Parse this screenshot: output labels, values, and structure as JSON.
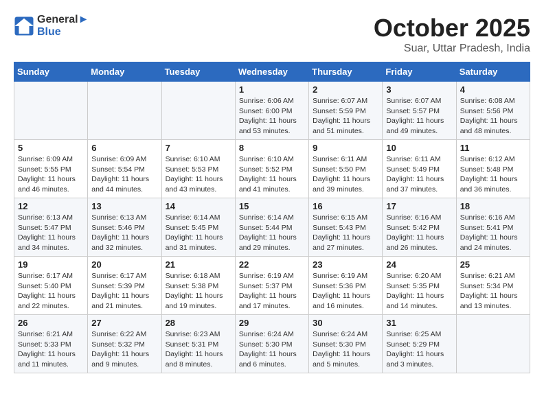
{
  "header": {
    "logo_line1": "General",
    "logo_line2": "Blue",
    "month": "October 2025",
    "location": "Suar, Uttar Pradesh, India"
  },
  "weekdays": [
    "Sunday",
    "Monday",
    "Tuesday",
    "Wednesday",
    "Thursday",
    "Friday",
    "Saturday"
  ],
  "weeks": [
    [
      {
        "day": "",
        "info": ""
      },
      {
        "day": "",
        "info": ""
      },
      {
        "day": "",
        "info": ""
      },
      {
        "day": "1",
        "info": "Sunrise: 6:06 AM\nSunset: 6:00 PM\nDaylight: 11 hours and 53 minutes."
      },
      {
        "day": "2",
        "info": "Sunrise: 6:07 AM\nSunset: 5:59 PM\nDaylight: 11 hours and 51 minutes."
      },
      {
        "day": "3",
        "info": "Sunrise: 6:07 AM\nSunset: 5:57 PM\nDaylight: 11 hours and 49 minutes."
      },
      {
        "day": "4",
        "info": "Sunrise: 6:08 AM\nSunset: 5:56 PM\nDaylight: 11 hours and 48 minutes."
      }
    ],
    [
      {
        "day": "5",
        "info": "Sunrise: 6:09 AM\nSunset: 5:55 PM\nDaylight: 11 hours and 46 minutes."
      },
      {
        "day": "6",
        "info": "Sunrise: 6:09 AM\nSunset: 5:54 PM\nDaylight: 11 hours and 44 minutes."
      },
      {
        "day": "7",
        "info": "Sunrise: 6:10 AM\nSunset: 5:53 PM\nDaylight: 11 hours and 43 minutes."
      },
      {
        "day": "8",
        "info": "Sunrise: 6:10 AM\nSunset: 5:52 PM\nDaylight: 11 hours and 41 minutes."
      },
      {
        "day": "9",
        "info": "Sunrise: 6:11 AM\nSunset: 5:50 PM\nDaylight: 11 hours and 39 minutes."
      },
      {
        "day": "10",
        "info": "Sunrise: 6:11 AM\nSunset: 5:49 PM\nDaylight: 11 hours and 37 minutes."
      },
      {
        "day": "11",
        "info": "Sunrise: 6:12 AM\nSunset: 5:48 PM\nDaylight: 11 hours and 36 minutes."
      }
    ],
    [
      {
        "day": "12",
        "info": "Sunrise: 6:13 AM\nSunset: 5:47 PM\nDaylight: 11 hours and 34 minutes."
      },
      {
        "day": "13",
        "info": "Sunrise: 6:13 AM\nSunset: 5:46 PM\nDaylight: 11 hours and 32 minutes."
      },
      {
        "day": "14",
        "info": "Sunrise: 6:14 AM\nSunset: 5:45 PM\nDaylight: 11 hours and 31 minutes."
      },
      {
        "day": "15",
        "info": "Sunrise: 6:14 AM\nSunset: 5:44 PM\nDaylight: 11 hours and 29 minutes."
      },
      {
        "day": "16",
        "info": "Sunrise: 6:15 AM\nSunset: 5:43 PM\nDaylight: 11 hours and 27 minutes."
      },
      {
        "day": "17",
        "info": "Sunrise: 6:16 AM\nSunset: 5:42 PM\nDaylight: 11 hours and 26 minutes."
      },
      {
        "day": "18",
        "info": "Sunrise: 6:16 AM\nSunset: 5:41 PM\nDaylight: 11 hours and 24 minutes."
      }
    ],
    [
      {
        "day": "19",
        "info": "Sunrise: 6:17 AM\nSunset: 5:40 PM\nDaylight: 11 hours and 22 minutes."
      },
      {
        "day": "20",
        "info": "Sunrise: 6:17 AM\nSunset: 5:39 PM\nDaylight: 11 hours and 21 minutes."
      },
      {
        "day": "21",
        "info": "Sunrise: 6:18 AM\nSunset: 5:38 PM\nDaylight: 11 hours and 19 minutes."
      },
      {
        "day": "22",
        "info": "Sunrise: 6:19 AM\nSunset: 5:37 PM\nDaylight: 11 hours and 17 minutes."
      },
      {
        "day": "23",
        "info": "Sunrise: 6:19 AM\nSunset: 5:36 PM\nDaylight: 11 hours and 16 minutes."
      },
      {
        "day": "24",
        "info": "Sunrise: 6:20 AM\nSunset: 5:35 PM\nDaylight: 11 hours and 14 minutes."
      },
      {
        "day": "25",
        "info": "Sunrise: 6:21 AM\nSunset: 5:34 PM\nDaylight: 11 hours and 13 minutes."
      }
    ],
    [
      {
        "day": "26",
        "info": "Sunrise: 6:21 AM\nSunset: 5:33 PM\nDaylight: 11 hours and 11 minutes."
      },
      {
        "day": "27",
        "info": "Sunrise: 6:22 AM\nSunset: 5:32 PM\nDaylight: 11 hours and 9 minutes."
      },
      {
        "day": "28",
        "info": "Sunrise: 6:23 AM\nSunset: 5:31 PM\nDaylight: 11 hours and 8 minutes."
      },
      {
        "day": "29",
        "info": "Sunrise: 6:24 AM\nSunset: 5:30 PM\nDaylight: 11 hours and 6 minutes."
      },
      {
        "day": "30",
        "info": "Sunrise: 6:24 AM\nSunset: 5:30 PM\nDaylight: 11 hours and 5 minutes."
      },
      {
        "day": "31",
        "info": "Sunrise: 6:25 AM\nSunset: 5:29 PM\nDaylight: 11 hours and 3 minutes."
      },
      {
        "day": "",
        "info": ""
      }
    ]
  ]
}
